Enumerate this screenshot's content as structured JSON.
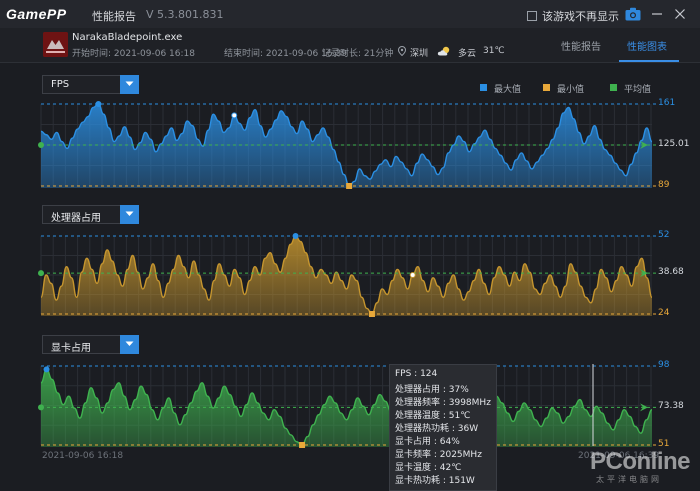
{
  "app": {
    "logo": "GamePP",
    "title": "性能报告",
    "version": "V 5.3.801.831",
    "hide_checkbox_label": "该游戏不再显示"
  },
  "info": {
    "game_name": "NarakaBladepoint.exe",
    "start": "开始时间: 2021-09-06 16:18",
    "end": "结束时间: 2021-09-06 16:39",
    "duration": "记录时长: 21分钟",
    "location": "深圳",
    "weather": "多云",
    "temperature": "31℃"
  },
  "tabs": [
    {
      "label": "性能报告",
      "active": false
    },
    {
      "label": "性能图表",
      "active": true
    }
  ],
  "legend": [
    {
      "label": "最大值",
      "color": "#2b8fe3"
    },
    {
      "label": "最小值",
      "color": "#e8a83a"
    },
    {
      "label": "平均值",
      "color": "#3fb24f"
    }
  ],
  "chart_data": [
    {
      "type": "area",
      "title": "FPS",
      "max": 161,
      "min": 89,
      "avg": 125.01,
      "ylim": [
        89,
        161
      ],
      "color": "#2b8fe3",
      "values": [
        137,
        134,
        130,
        136,
        128,
        122,
        131,
        139,
        145,
        150,
        158,
        161,
        152,
        140,
        128,
        133,
        141,
        132,
        121,
        127,
        136,
        130,
        119,
        126,
        133,
        140,
        129,
        135,
        146,
        142,
        130,
        124,
        138,
        152,
        146,
        136,
        140,
        151,
        144,
        138,
        149,
        156,
        142,
        132,
        139,
        147,
        155,
        150,
        141,
        135,
        146,
        139,
        128,
        134,
        140,
        132,
        121,
        110,
        99,
        89,
        93,
        104,
        98,
        95,
        102,
        108,
        112,
        106,
        115,
        110,
        104,
        98,
        109,
        117,
        112,
        106,
        99,
        105,
        118,
        125,
        133,
        128,
        119,
        126,
        132,
        138,
        130,
        122,
        116,
        109,
        103,
        112,
        118,
        111,
        104,
        110,
        116,
        122,
        130,
        140,
        153,
        158,
        148,
        136,
        126,
        133,
        142,
        130,
        121,
        116,
        109,
        103,
        98,
        108,
        118,
        129,
        140,
        128
      ]
    },
    {
      "type": "area",
      "title": "处理器占用",
      "max": 52,
      "min": 24,
      "avg": 38.68,
      "ylim": [
        24,
        52
      ],
      "color": "#c5952e",
      "values": [
        30,
        38,
        35,
        29,
        34,
        41,
        37,
        30,
        39,
        44,
        40,
        35,
        42,
        47,
        43,
        38,
        34,
        40,
        45,
        39,
        33,
        37,
        42,
        36,
        30,
        35,
        40,
        45,
        41,
        37,
        43,
        38,
        33,
        29,
        36,
        42,
        38,
        34,
        40,
        37,
        31,
        36,
        41,
        38,
        44,
        46,
        42,
        39,
        44,
        49,
        52,
        50,
        46,
        41,
        37,
        40,
        38,
        35,
        39,
        36,
        33,
        38,
        36,
        30,
        26,
        24,
        28,
        33,
        31,
        36,
        40,
        37,
        33,
        38,
        41,
        36,
        32,
        37,
        34,
        30,
        35,
        38,
        33,
        29,
        32,
        36,
        40,
        35,
        31,
        37,
        41,
        38,
        34,
        39,
        36,
        42,
        39,
        33,
        31,
        35,
        38,
        34,
        30,
        34,
        42,
        39,
        34,
        30,
        28,
        33,
        40,
        37,
        32,
        36,
        41,
        38,
        34,
        41,
        44,
        37,
        30
      ]
    },
    {
      "type": "area",
      "title": "显卡占用",
      "max": 98,
      "min": 51,
      "avg": 73.38,
      "ylim": [
        51,
        98
      ],
      "color": "#3fb24f",
      "values": [
        88,
        96,
        90,
        82,
        75,
        80,
        73,
        67,
        76,
        85,
        79,
        70,
        76,
        84,
        88,
        80,
        72,
        78,
        86,
        81,
        72,
        66,
        73,
        79,
        70,
        63,
        69,
        76,
        83,
        88,
        80,
        73,
        79,
        86,
        81,
        74,
        68,
        75,
        82,
        76,
        70,
        66,
        72,
        68,
        61,
        57,
        53,
        51,
        56,
        63,
        69,
        75,
        80,
        76,
        70,
        66,
        72,
        79,
        74,
        69,
        75,
        81,
        77,
        71,
        67,
        73,
        78,
        72,
        66,
        71,
        77,
        83,
        78,
        72,
        68,
        74,
        80,
        75,
        69,
        64,
        69,
        75,
        80,
        76,
        70,
        65,
        71,
        76,
        72,
        66,
        62,
        67,
        73,
        70,
        64,
        68,
        74,
        78,
        72,
        68,
        74,
        70,
        64,
        60,
        66,
        72,
        68,
        62,
        58,
        66,
        72
      ]
    }
  ],
  "time_axis": {
    "start": "2021-09-06 16:18",
    "end": "2021-09-06 16:39"
  },
  "tooltip": [
    "FPS : 124",
    "处理器占用 : 37%",
    "处理器频率 : 3998MHz",
    "处理器温度 : 51℃",
    "处理器热功耗 : 36W",
    "显卡占用 : 64%",
    "显卡频率 : 2025MHz",
    "显卡温度 : 42℃",
    "显卡热功耗 : 151W"
  ],
  "watermark": {
    "main": "PConline",
    "sub": "太平洋电脑网"
  }
}
